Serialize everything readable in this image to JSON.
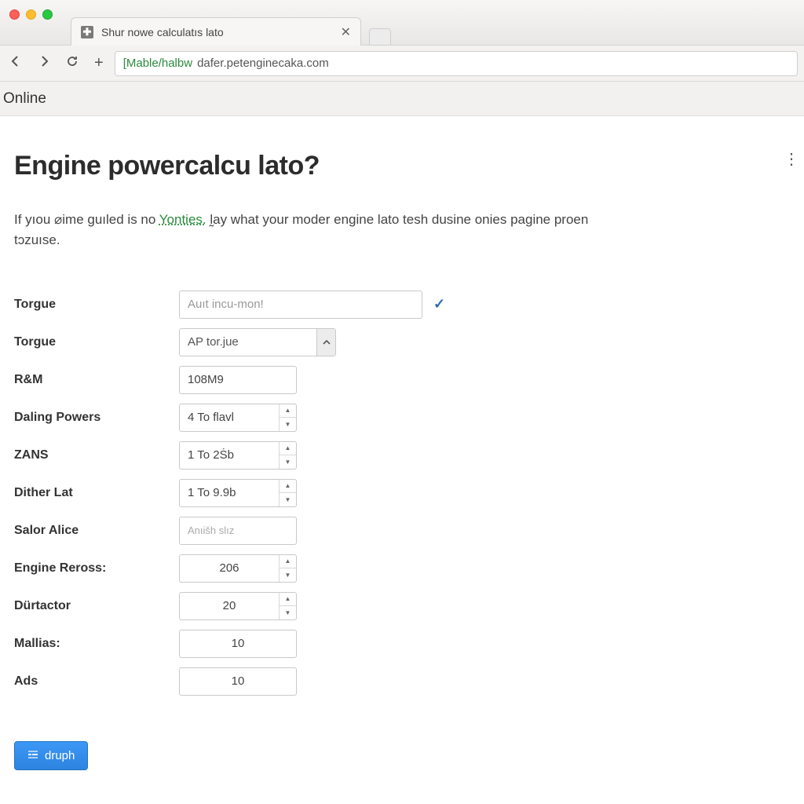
{
  "browser": {
    "tab_title": "Shur nowe calculatıs lato",
    "url_prefix": "[Mable/halbw",
    "url_rest": " dafer.petenginecaka.com"
  },
  "subbar": {
    "label": "Online"
  },
  "page": {
    "title": "Engine powercalcu lato?",
    "intro_a": "If yıou ⌀ime guıled is no ",
    "intro_link": "Yonties.",
    "intro_b": " l̰ay what your moder engine lato tesh dusine onies pagine proen tɔzuıse."
  },
  "form": {
    "torque1": {
      "label": "Torgue",
      "placeholder": "Auıt incu-mon!"
    },
    "torque2": {
      "label": "Torgue",
      "selected": "AP tor.jue"
    },
    "rm": {
      "label": "R&M",
      "value": "108M9"
    },
    "daling": {
      "label": "Daling Powers",
      "value": "4 To flavl"
    },
    "zans": {
      "label": "ZANS",
      "value": "1 To 2Ṡb"
    },
    "dither": {
      "label": "Dither Lаt",
      "value": "1 To 9.9b"
    },
    "salor": {
      "label": "Salor Alice",
      "placeholder": "Anıišh slız"
    },
    "engine_reross": {
      "label": "Engine Reross:",
      "value": "206"
    },
    "durtactor": {
      "label": "Dürtactor",
      "value": "20"
    },
    "mallias": {
      "label": "Mallias:",
      "value": "10"
    },
    "ads": {
      "label": "Ads",
      "value": "10"
    }
  },
  "actions": {
    "submit": "druph"
  }
}
